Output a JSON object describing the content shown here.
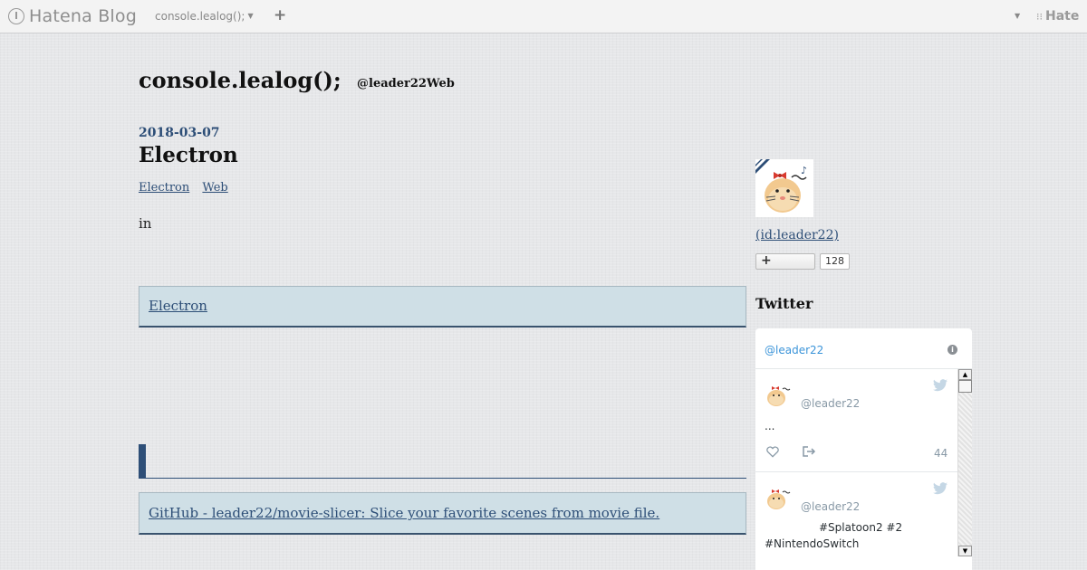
{
  "topbar": {
    "logo_text": "Hatena Blog",
    "blog_selector": "console.lealog();",
    "add_label": "+",
    "hatena_label": "Hate"
  },
  "header": {
    "blog_title": "console.lealog();",
    "blog_description": "@leader22Web"
  },
  "entry": {
    "date": "2018-03-07",
    "title": "Electron",
    "categories": [
      "Electron",
      "Web"
    ],
    "body_text": "in",
    "embed_link_1": "Electron",
    "embed_link_2": "GitHub - leader22/movie-slicer: Slice your favorite scenes from movie file."
  },
  "sidebar": {
    "profile_link": " (id:leader22)",
    "follow_button": "+",
    "follow_count": "128",
    "module_title": "Twitter",
    "twitter": {
      "header_handle": "@leader22",
      "tweets": [
        {
          "handle": "@leader22",
          "text": "...",
          "like_count": "44"
        },
        {
          "handle": "@leader22",
          "text_line1": "#Splatoon2 #2",
          "text_line2": "#NintendoSwitch"
        }
      ]
    }
  },
  "colors": {
    "accent": "#2d4e77",
    "card_bg": "#cfdfe6",
    "twitter_blue": "#3b94d9"
  }
}
